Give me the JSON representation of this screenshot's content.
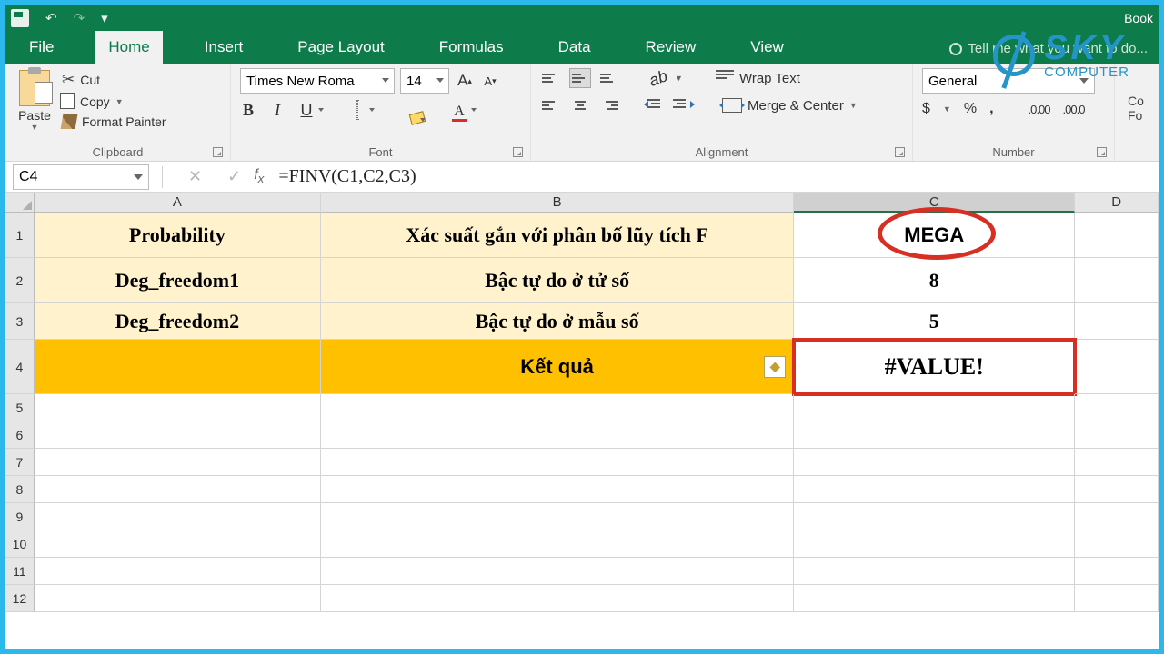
{
  "title_right": "Book",
  "qat": {
    "undo": "↶",
    "redo": "↷",
    "more": "▾"
  },
  "tabs": [
    "File",
    "Home",
    "Insert",
    "Page Layout",
    "Formulas",
    "Data",
    "Review",
    "View"
  ],
  "active_tab": "Home",
  "tell_me": "Tell me what you want to do...",
  "clipboard": {
    "paste": "Paste",
    "cut": "Cut",
    "copy": "Copy",
    "fp": "Format Painter",
    "label": "Clipboard"
  },
  "font": {
    "name": "Times New Roma",
    "size": "14",
    "bold": "B",
    "italic": "I",
    "under": "U",
    "fcolor": "A",
    "label": "Font",
    "grow": "A",
    "shrink": "A"
  },
  "alignment": {
    "wrap": "Wrap Text",
    "merge": "Merge & Center",
    "label": "Alignment",
    "orient": "ab"
  },
  "number": {
    "format": "General",
    "label": "Number",
    "dollar": "$",
    "pct": "%",
    "comma": ",",
    "dec_inc": ".0 .00",
    "dec_dec": ".00 .0",
    "cells": "Co\nFo"
  },
  "logo": {
    "sky": "SKY",
    "sub": "COMPUTER"
  },
  "namebox": "C4",
  "formula": "=FINV(C1,C2,C3)",
  "cols": [
    "A",
    "B",
    "C",
    "D"
  ],
  "rows": [
    "1",
    "2",
    "3",
    "4",
    "5",
    "6",
    "7",
    "8",
    "9",
    "10",
    "11",
    "12"
  ],
  "sheet": {
    "A1": "Probability",
    "B1": "Xác suất gắn với phân bố lũy tích F",
    "C1": "MEGA",
    "A2": "Deg_freedom1",
    "B2": "Bậc tự do ở tử số",
    "C2": "8",
    "A3": "Deg_freedom2",
    "B3": "Bậc tự do ở mẫu số",
    "C3": "5",
    "B4": "Kết quả",
    "C4": "#VALUE!"
  }
}
